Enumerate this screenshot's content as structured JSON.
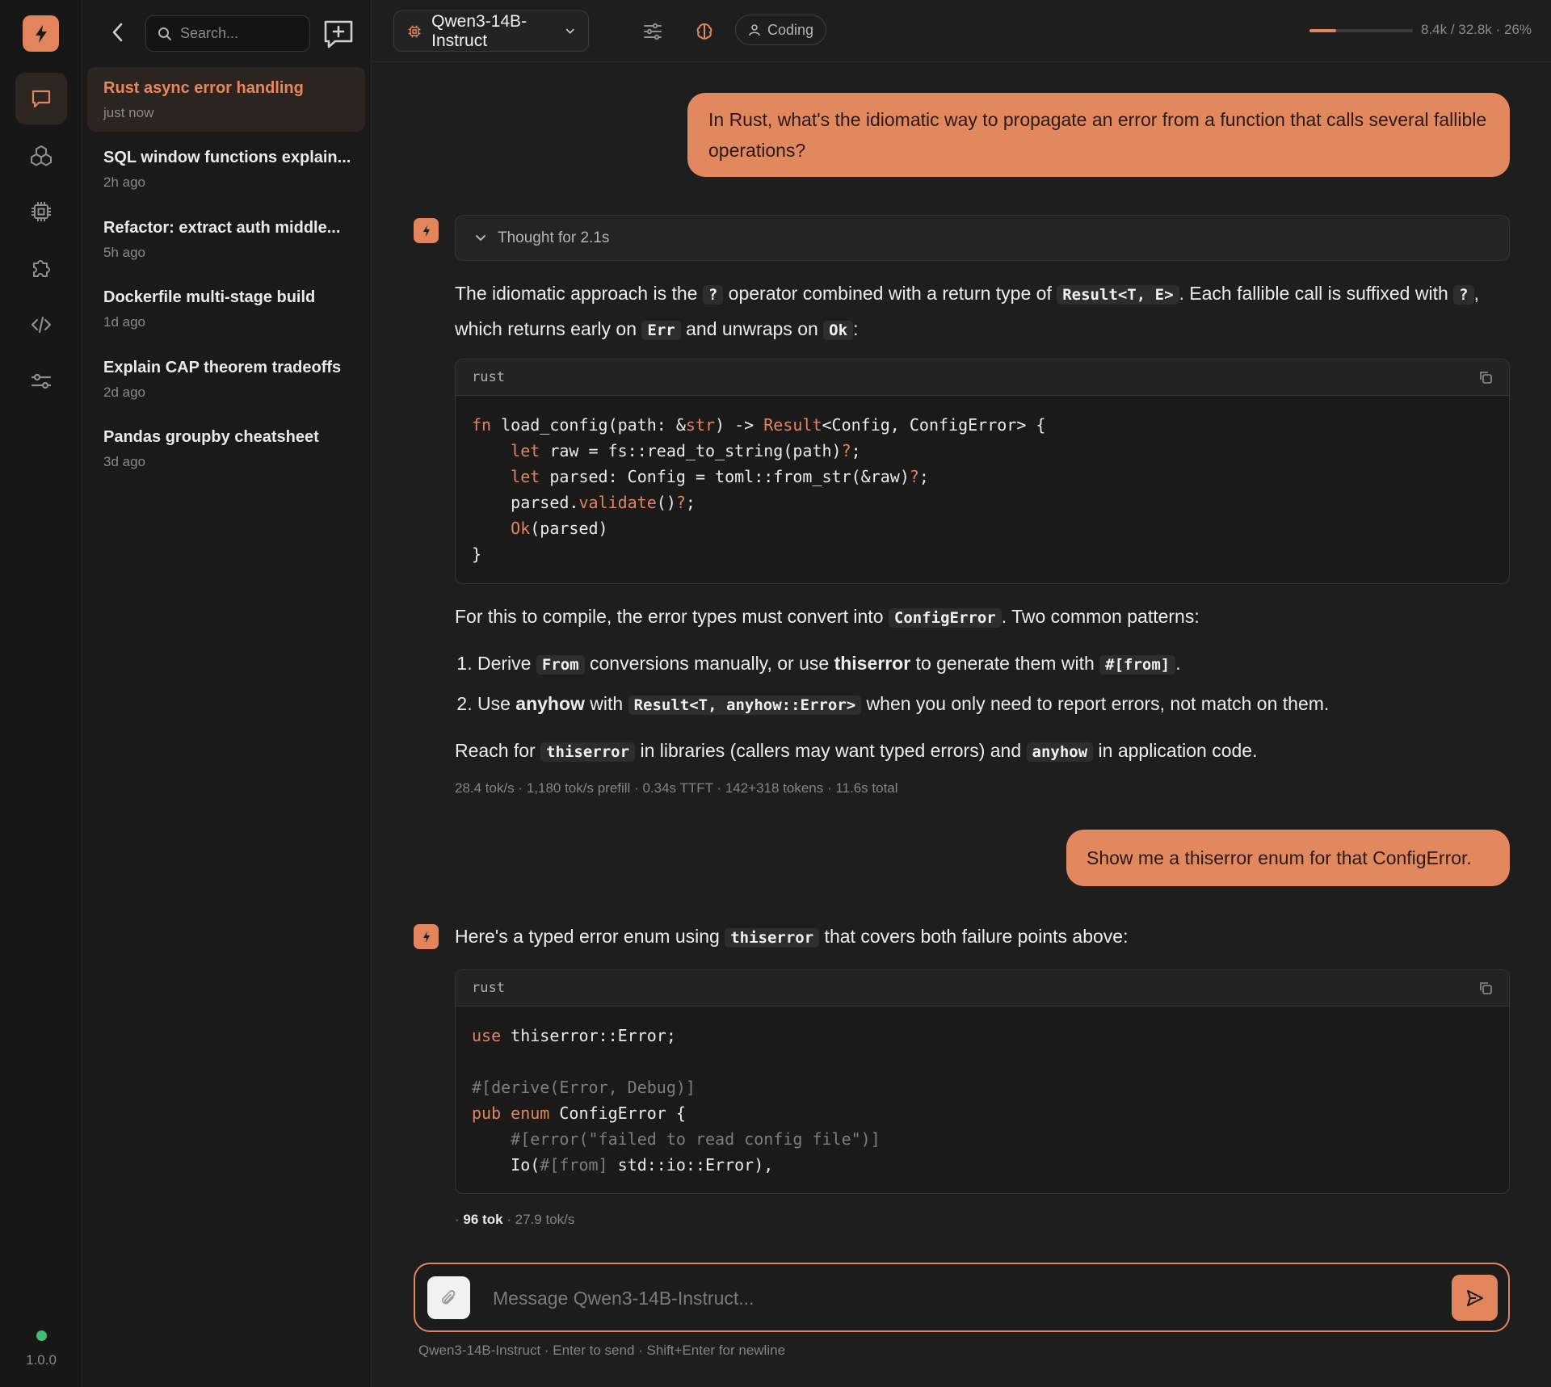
{
  "app": {
    "version": "1.0.0",
    "accent": "#e2855c",
    "status_color": "#3fbf74"
  },
  "rail": {
    "items": [
      {
        "name": "chat",
        "icon": "chat-bubble-icon",
        "active": true
      },
      {
        "name": "models",
        "icon": "cubes-icon",
        "active": false
      },
      {
        "name": "hardware",
        "icon": "chip-icon",
        "active": false
      },
      {
        "name": "plugins",
        "icon": "puzzle-icon",
        "active": false
      },
      {
        "name": "developer",
        "icon": "code-icon",
        "active": false
      },
      {
        "name": "settings",
        "icon": "sliders-icon",
        "active": false
      }
    ]
  },
  "sidebar": {
    "search_placeholder": "Search...",
    "conversations": [
      {
        "title": "Rust async error handling",
        "time": "just now",
        "active": true
      },
      {
        "title": "SQL window functions explain...",
        "time": "2h ago",
        "active": false
      },
      {
        "title": "Refactor: extract auth middle...",
        "time": "5h ago",
        "active": false
      },
      {
        "title": "Dockerfile multi-stage build",
        "time": "1d ago",
        "active": false
      },
      {
        "title": "Explain CAP theorem tradeoffs",
        "time": "2d ago",
        "active": false
      },
      {
        "title": "Pandas groupby cheatsheet",
        "time": "3d ago",
        "active": false
      }
    ]
  },
  "topbar": {
    "model": "Qwen3-14B-Instruct",
    "mode": "Coding",
    "context_fraction": 0.26,
    "context_text": "8.4k / 32.8k · 26%"
  },
  "messages": {
    "user1": "In Rust, what's the idiomatic way to propagate an error from a function that calls several fallible operations?",
    "thought_label": "Thought for 2.1s",
    "a1": {
      "p1": [
        "The idiomatic approach is the ",
        "?",
        " operator combined with a return type of ",
        "Result<T, E>",
        ". Each fallible call is suffixed with ",
        "?",
        ", which returns early on ",
        "Err",
        " and unwraps on ",
        "Ok",
        ":"
      ],
      "code_lang": "rust",
      "code": [
        [
          "fn",
          " load_config(path: &",
          "str",
          ") -> ",
          "Result",
          "<Config, ConfigError> {"
        ],
        [
          "    ",
          "let",
          " raw = fs::read_to_string(path)",
          "?",
          ";"
        ],
        [
          "    ",
          "let",
          " parsed: Config = toml::from_str(&raw)",
          "?",
          ";"
        ],
        [
          "    parsed.",
          "validate",
          "()",
          "?",
          ";"
        ],
        [
          "    ",
          "Ok",
          "(parsed)"
        ],
        [
          "}"
        ]
      ],
      "p2": [
        "For this to compile, the error types must convert into ",
        "ConfigError",
        ". Two common patterns:"
      ],
      "li1": [
        "Derive ",
        "From",
        " conversions manually, or use ",
        "thiserror",
        " to generate them with ",
        "#[from]",
        "."
      ],
      "li2": [
        "Use ",
        "anyhow",
        " with ",
        "Result<T, anyhow::Error>",
        " when you only need to report errors, not match on them."
      ],
      "p3": [
        "Reach for ",
        "thiserror",
        " in libraries (callers may want typed errors) and ",
        "anyhow",
        " in application code."
      ],
      "stats": "28.4 tok/s · 1,180 tok/s prefill · 0.34s TTFT · 142+318 tokens · 11.6s total"
    },
    "user2": "Show me a thiserror enum for that ConfigError.",
    "a2": {
      "intro": [
        "Here's a typed error enum using ",
        "thiserror",
        " that covers both failure points above:"
      ],
      "code_lang": "rust",
      "code": [
        [
          "use",
          " thiserror::Error;"
        ],
        [
          ""
        ],
        [
          "#[derive(Error, Debug)]"
        ],
        [
          "pub",
          " ",
          "enum",
          " ConfigError {"
        ],
        [
          "    ",
          "#[error(\"failed to read config file\")]"
        ],
        [
          "    Io(",
          "#[from]",
          " std::io::Error),"
        ]
      ],
      "tok": "96 tok",
      "rate": "· 27.9 tok/s",
      "dot": "·"
    }
  },
  "composer": {
    "placeholder": "Message Qwen3-14B-Instruct...",
    "hint": "Qwen3-14B-Instruct · Enter to send · Shift+Enter for newline"
  }
}
